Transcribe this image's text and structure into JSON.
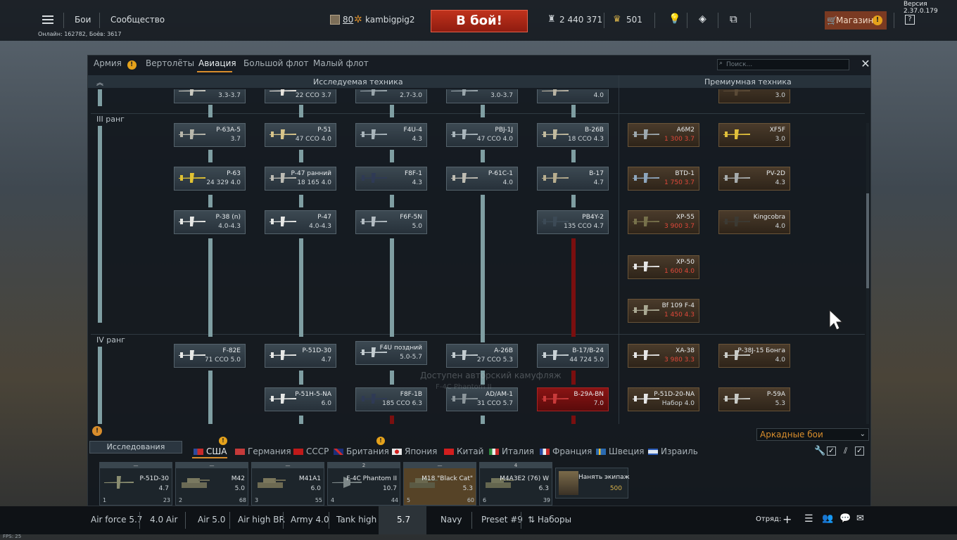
{
  "version": "Версия 2.37.0.179",
  "fps": "FPS: 25",
  "topbar": {
    "menu_icon": "hamburger-icon",
    "battles": "Бои",
    "community": "Сообщество",
    "player_level": "80",
    "player_name": "kambigpig2",
    "battle_button": "В бой!",
    "silver_lions": "2 440 371",
    "golden_eagles": "501",
    "shop": "Магазин",
    "help": "?",
    "online": "Онлайн: 162782, Боёв: 3617"
  },
  "tabs": [
    {
      "label": "Армия",
      "badge": "!"
    },
    {
      "label": "Вертолёты"
    },
    {
      "label": "Авиация"
    },
    {
      "label": "Большой флот"
    },
    {
      "label": "Малый флот"
    }
  ],
  "search": {
    "placeholder": "Поиск..."
  },
  "columns": {
    "researchable": "Исследуемая техника",
    "premium": "Премиумная техника"
  },
  "ranks": {
    "r3": "III ранг",
    "r4": "IV ранг"
  },
  "tree_cards": {
    "top": [
      {
        "name": "",
        "br": "3.3-3.7"
      },
      {
        "name": "",
        "br": "22 CCO 3.7"
      },
      {
        "name": "",
        "br": "2.7-3.0"
      },
      {
        "name": "",
        "br": "3.0-3.7"
      },
      {
        "name": "",
        "br": "4.0"
      },
      {
        "name": "",
        "br": "3.0"
      }
    ],
    "c1": [
      {
        "name": "P-63A-5",
        "br": "3.7"
      },
      {
        "name": "P-63",
        "br": "24 329 4.0"
      },
      {
        "name": "P-38 (n)",
        "br": "4.0-4.3"
      },
      {
        "name": "F-82E",
        "br": "71 CCO 5.0"
      },
      {
        "name": "",
        "br": ""
      }
    ],
    "c2": [
      {
        "name": "P-51",
        "br": "47 CCO 4.0"
      },
      {
        "name": "P-47 ранний",
        "br": "18 165 4.0"
      },
      {
        "name": "P-47",
        "br": "4.0-4.3"
      },
      {
        "name": "P-51D-30",
        "br": "4.7"
      },
      {
        "name": "P-51H-5-NA",
        "br": "6.0"
      }
    ],
    "c3": [
      {
        "name": "F4U-4",
        "br": "4.3"
      },
      {
        "name": "F8F-1",
        "br": "4.3"
      },
      {
        "name": "F6F-5N",
        "br": "5.0"
      },
      {
        "name": "F4U поздний",
        "br": "5.0-5.7"
      },
      {
        "name": "F8F-1B",
        "br": "185 CCO 6.3"
      }
    ],
    "c4": [
      {
        "name": "PBJ-1J",
        "br": "47 CCO 4.0"
      },
      {
        "name": "P-61C-1",
        "br": "4.0"
      },
      {
        "name": "A-26B",
        "br": "27 CCO 5.3"
      },
      {
        "name": "AD/AM-1",
        "br": "31 CCO 5.7"
      }
    ],
    "c5": [
      {
        "name": "B-26B",
        "br": "18 CCO 4.3"
      },
      {
        "name": "B-17",
        "br": "4.7"
      },
      {
        "name": "PB4Y-2",
        "br": "135 CCO 4.7"
      },
      {
        "name": "B-17/B-24",
        "br": "44 724 5.0"
      },
      {
        "name": "B-29A-BN",
        "br": "7.0"
      }
    ],
    "p1": [
      {
        "name": "A6M2",
        "br": "1 300 3.7"
      },
      {
        "name": "BTD-1",
        "br": "1 750 3.7"
      },
      {
        "name": "XP-55",
        "br": "3 900 3.7"
      },
      {
        "name": "XP-50",
        "br": "1 600 4.0"
      },
      {
        "name": "Bf 109 F-4",
        "br": "1 450 4.3"
      },
      {
        "name": "XA-38",
        "br": "3 980 3.3"
      },
      {
        "name": "P-51D-20-NA",
        "br": "Набор 4.0"
      }
    ],
    "p2": [
      {
        "name": "XF5F",
        "br": "3.0"
      },
      {
        "name": "PV-2D",
        "br": "4.3"
      },
      {
        "name": "Kingcobra",
        "br": "4.0"
      },
      {
        "name": "P-38J-15 Бонга",
        "br": "4.0"
      },
      {
        "name": "P-59A",
        "br": "5.3"
      }
    ]
  },
  "watermark": {
    "line1": "Доступен авторский камуфляж",
    "line2": "F-4C Phantom II"
  },
  "mode_select": "Аркадные бои",
  "research_button": "Исследования",
  "nations": [
    {
      "label": "США",
      "color": "#2d4b9c"
    },
    {
      "label": "Германия",
      "color": "#333333"
    },
    {
      "label": "СССР",
      "color": "#c01a1a"
    },
    {
      "label": "Британия",
      "color": "#1d2f7a"
    },
    {
      "label": "Япония",
      "color": "#e7e7e7"
    },
    {
      "label": "Китай",
      "color": "#d21e1e"
    },
    {
      "label": "Италия",
      "color": "#2b8a3e"
    },
    {
      "label": "Франция",
      "color": "#2448a0"
    },
    {
      "label": "Швеция",
      "color": "#2a6ab1"
    },
    {
      "label": "Израиль",
      "color": "#dde6f2"
    }
  ],
  "crew_slots": [
    {
      "top": "—",
      "name": "P-51D-30",
      "br": "4.7",
      "num": "1",
      "pts": "23"
    },
    {
      "top": "—",
      "name": "M42",
      "br": "5.0",
      "num": "2",
      "pts": "68"
    },
    {
      "top": "—",
      "name": "M41A1",
      "br": "6.0",
      "num": "3",
      "pts": "55"
    },
    {
      "top": "2",
      "name": "F-4C Phantom II",
      "br": "10.7",
      "num": "4",
      "pts": "44"
    },
    {
      "top": "—",
      "name": "M18 \"Black Cat\"",
      "br": "5.3",
      "num": "5",
      "pts": "60"
    },
    {
      "top": "4",
      "name": "M4A3E2 (76) W",
      "br": "6.3",
      "num": "6",
      "pts": "39"
    }
  ],
  "hire_crew": {
    "label": "Нанять экипаж",
    "cost": "500"
  },
  "presets": [
    "Air force 5.7",
    "4.0 Air",
    "Air 5.0",
    "Air high BR",
    "Army 4.0",
    "Tank high",
    "5.7",
    "Navy",
    "Preset #9"
  ],
  "presets_menu": "Наборы",
  "squad": "Отряд:"
}
